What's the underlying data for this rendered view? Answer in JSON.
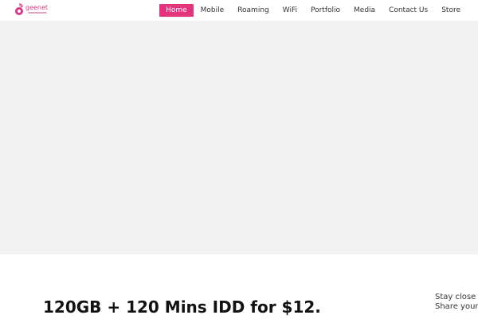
{
  "header": {
    "logo": {
      "text": "geenet",
      "icon": "geenet-logo-icon"
    },
    "nav": [
      {
        "label": "Home",
        "active": true
      },
      {
        "label": "Mobile",
        "active": false
      },
      {
        "label": "Roaming",
        "active": false
      },
      {
        "label": "WiFi",
        "active": false
      },
      {
        "label": "Portfolio",
        "active": false
      },
      {
        "label": "Media",
        "active": false
      },
      {
        "label": "Contact Us",
        "active": false
      },
      {
        "label": "Store",
        "active": false
      }
    ]
  },
  "main": {
    "headline": "120GB + 120 Mins IDD for $12.",
    "side_text": {
      "line1": "Stay close to",
      "line2": "Share your li"
    }
  },
  "colors": {
    "accent": "#e4347d",
    "hero_background": "#f2f2f2",
    "text": "#111111"
  }
}
